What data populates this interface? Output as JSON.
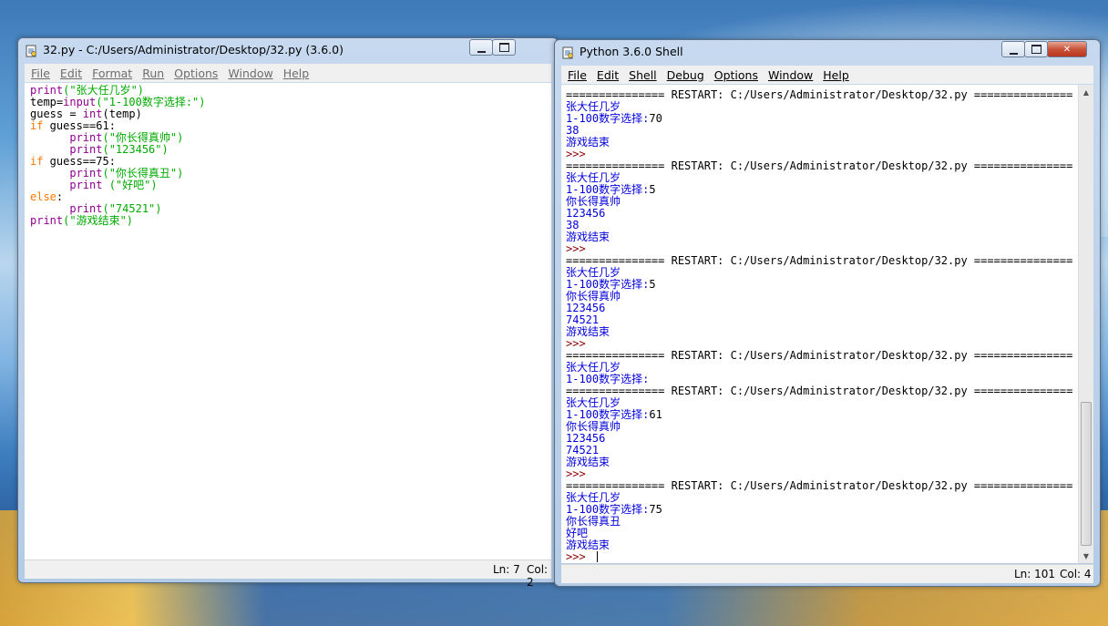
{
  "editor": {
    "title": "32.py - C:/Users/Administrator/Desktop/32.py (3.6.0)",
    "menu": [
      {
        "label": "File"
      },
      {
        "label": "Edit"
      },
      {
        "label": "Format"
      },
      {
        "label": "Run"
      },
      {
        "label": "Options"
      },
      {
        "label": "Window"
      },
      {
        "label": "Help"
      }
    ],
    "code": [
      [
        {
          "t": "print",
          "c": "bi"
        },
        {
          "t": "(\"张大任几岁\")",
          "c": "st"
        }
      ],
      [
        {
          "t": "temp=",
          "c": "df"
        },
        {
          "t": "input",
          "c": "bi"
        },
        {
          "t": "(\"1-100数字选择:\")",
          "c": "st"
        }
      ],
      [
        {
          "t": "guess = ",
          "c": "df"
        },
        {
          "t": "int",
          "c": "bi"
        },
        {
          "t": "(temp)",
          "c": "df"
        }
      ],
      [
        {
          "t": "if",
          "c": "kw"
        },
        {
          "t": " guess==61:",
          "c": "df"
        }
      ],
      [
        {
          "t": "      ",
          "c": "df"
        },
        {
          "t": "print",
          "c": "bi"
        },
        {
          "t": "(\"你长得真帅\")",
          "c": "st"
        }
      ],
      [
        {
          "t": "      ",
          "c": "df"
        },
        {
          "t": "print",
          "c": "bi"
        },
        {
          "t": "(\"123456\")",
          "c": "st"
        }
      ],
      [
        {
          "t": "if",
          "c": "kw"
        },
        {
          "t": " guess==75:",
          "c": "df"
        }
      ],
      [
        {
          "t": "      ",
          "c": "df"
        },
        {
          "t": "print",
          "c": "bi"
        },
        {
          "t": "(\"你长得真丑\")",
          "c": "st"
        }
      ],
      [
        {
          "t": "      ",
          "c": "df"
        },
        {
          "t": "print",
          "c": "bi"
        },
        {
          "t": " (\"好吧\")",
          "c": "st"
        }
      ],
      [
        {
          "t": "else",
          "c": "kw"
        },
        {
          "t": ":",
          "c": "df"
        }
      ],
      [
        {
          "t": "      ",
          "c": "df"
        },
        {
          "t": "print",
          "c": "bi"
        },
        {
          "t": "(\"74521\")",
          "c": "st"
        }
      ],
      [
        {
          "t": "print",
          "c": "bi"
        },
        {
          "t": "(\"游戏结束\")",
          "c": "st"
        }
      ]
    ],
    "status_ln": "Ln: 7",
    "status_col": "Col: 2"
  },
  "shell": {
    "title": "Python 3.6.0 Shell",
    "menu": [
      {
        "label": "File"
      },
      {
        "label": "Edit"
      },
      {
        "label": "Shell"
      },
      {
        "label": "Debug"
      },
      {
        "label": "Options"
      },
      {
        "label": "Window"
      },
      {
        "label": "Help"
      }
    ],
    "lines": [
      {
        "t": "=============== RESTART: C:/Users/Administrator/Desktop/32.py ===============",
        "c": ""
      },
      {
        "t": "张大任几岁",
        "c": "sh-out"
      },
      {
        "t": "1-100数字选择:",
        "c": "sh-out",
        "input": "70"
      },
      {
        "t": "38",
        "c": "sh-out"
      },
      {
        "t": "游戏结束",
        "c": "sh-out"
      },
      {
        "t": ">>> ",
        "c": "sh-prompt"
      },
      {
        "t": "=============== RESTART: C:/Users/Administrator/Desktop/32.py ===============",
        "c": ""
      },
      {
        "t": "张大任几岁",
        "c": "sh-out"
      },
      {
        "t": "1-100数字选择:",
        "c": "sh-out",
        "input": "5"
      },
      {
        "t": "你长得真帅",
        "c": "sh-out"
      },
      {
        "t": "123456",
        "c": "sh-out"
      },
      {
        "t": "38",
        "c": "sh-out"
      },
      {
        "t": "游戏结束",
        "c": "sh-out"
      },
      {
        "t": ">>> ",
        "c": "sh-prompt"
      },
      {
        "t": "=============== RESTART: C:/Users/Administrator/Desktop/32.py ===============",
        "c": ""
      },
      {
        "t": "张大任几岁",
        "c": "sh-out"
      },
      {
        "t": "1-100数字选择:",
        "c": "sh-out",
        "input": "5"
      },
      {
        "t": "你长得真帅",
        "c": "sh-out"
      },
      {
        "t": "123456",
        "c": "sh-out"
      },
      {
        "t": "74521",
        "c": "sh-out"
      },
      {
        "t": "游戏结束",
        "c": "sh-out"
      },
      {
        "t": ">>> ",
        "c": "sh-prompt"
      },
      {
        "t": "=============== RESTART: C:/Users/Administrator/Desktop/32.py ===============",
        "c": ""
      },
      {
        "t": "张大任几岁",
        "c": "sh-out"
      },
      {
        "t": "1-100数字选择:",
        "c": "sh-out"
      },
      {
        "t": "=============== RESTART: C:/Users/Administrator/Desktop/32.py ===============",
        "c": ""
      },
      {
        "t": "张大任几岁",
        "c": "sh-out"
      },
      {
        "t": "1-100数字选择:",
        "c": "sh-out",
        "input": "61"
      },
      {
        "t": "你长得真帅",
        "c": "sh-out"
      },
      {
        "t": "123456",
        "c": "sh-out"
      },
      {
        "t": "74521",
        "c": "sh-out"
      },
      {
        "t": "游戏结束",
        "c": "sh-out"
      },
      {
        "t": ">>> ",
        "c": "sh-prompt"
      },
      {
        "t": "=============== RESTART: C:/Users/Administrator/Desktop/32.py ===============",
        "c": ""
      },
      {
        "t": "张大任几岁",
        "c": "sh-out"
      },
      {
        "t": "1-100数字选择:",
        "c": "sh-out",
        "input": "75"
      },
      {
        "t": "你长得真丑",
        "c": "sh-out"
      },
      {
        "t": "好吧",
        "c": "sh-out"
      },
      {
        "t": "游戏结束",
        "c": "sh-out"
      },
      {
        "t": ">>> ",
        "c": "sh-prompt",
        "cursor": true
      }
    ],
    "status_ln": "Ln: 101",
    "status_col": "Col: 4"
  },
  "icons": {
    "window": "python-file-icon",
    "minimize": "minimize-icon",
    "maximize": "maximize-icon",
    "close": "close-icon"
  },
  "colors": {
    "keyword": "#ff7700",
    "builtin": "#900090",
    "string": "#00aa00",
    "shell_output": "#0000dd",
    "prompt": "#8b0000"
  }
}
